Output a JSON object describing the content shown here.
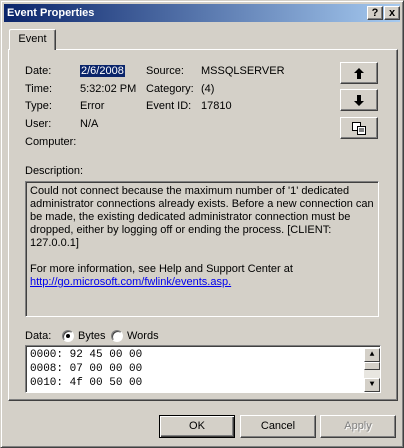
{
  "window": {
    "title": "Event Properties",
    "help_glyph": "?",
    "close_glyph": "x"
  },
  "tabs": [
    {
      "label": "Event"
    }
  ],
  "event": {
    "date_label": "Date:",
    "date": "2/6/2008",
    "time_label": "Time:",
    "time": "5:32:02 PM",
    "type_label": "Type:",
    "type": "Error",
    "user_label": "User:",
    "user": "N/A",
    "computer_label": "Computer:",
    "computer": "",
    "source_label": "Source:",
    "source": "MSSQLSERVER",
    "category_label": "Category:",
    "category": "(4)",
    "event_id_label": "Event ID:",
    "event_id": "17810"
  },
  "description": {
    "label": "Description:",
    "text": "Could not connect because the maximum number of '1' dedicated administrator connections already exists. Before a new connection can be made, the existing dedicated administrator connection must be dropped, either by logging off or ending the process. [CLIENT: 127.0.0.1]",
    "help_text": "For more information, see Help and Support Center at",
    "link": "http://go.microsoft.com/fwlink/events.asp."
  },
  "data": {
    "label": "Data:",
    "options": [
      "Bytes",
      "Words"
    ],
    "selected": "Bytes",
    "rows": [
      "0000: 92 45 00 00",
      "0008: 07 00 00 00",
      "0010: 4f 00 50 00"
    ]
  },
  "side_buttons": {
    "up_icon": "arrow-up-icon",
    "down_icon": "arrow-down-icon",
    "copy_icon": "copy-icon"
  },
  "buttons": {
    "ok": "OK",
    "cancel": "Cancel",
    "apply": "Apply"
  }
}
